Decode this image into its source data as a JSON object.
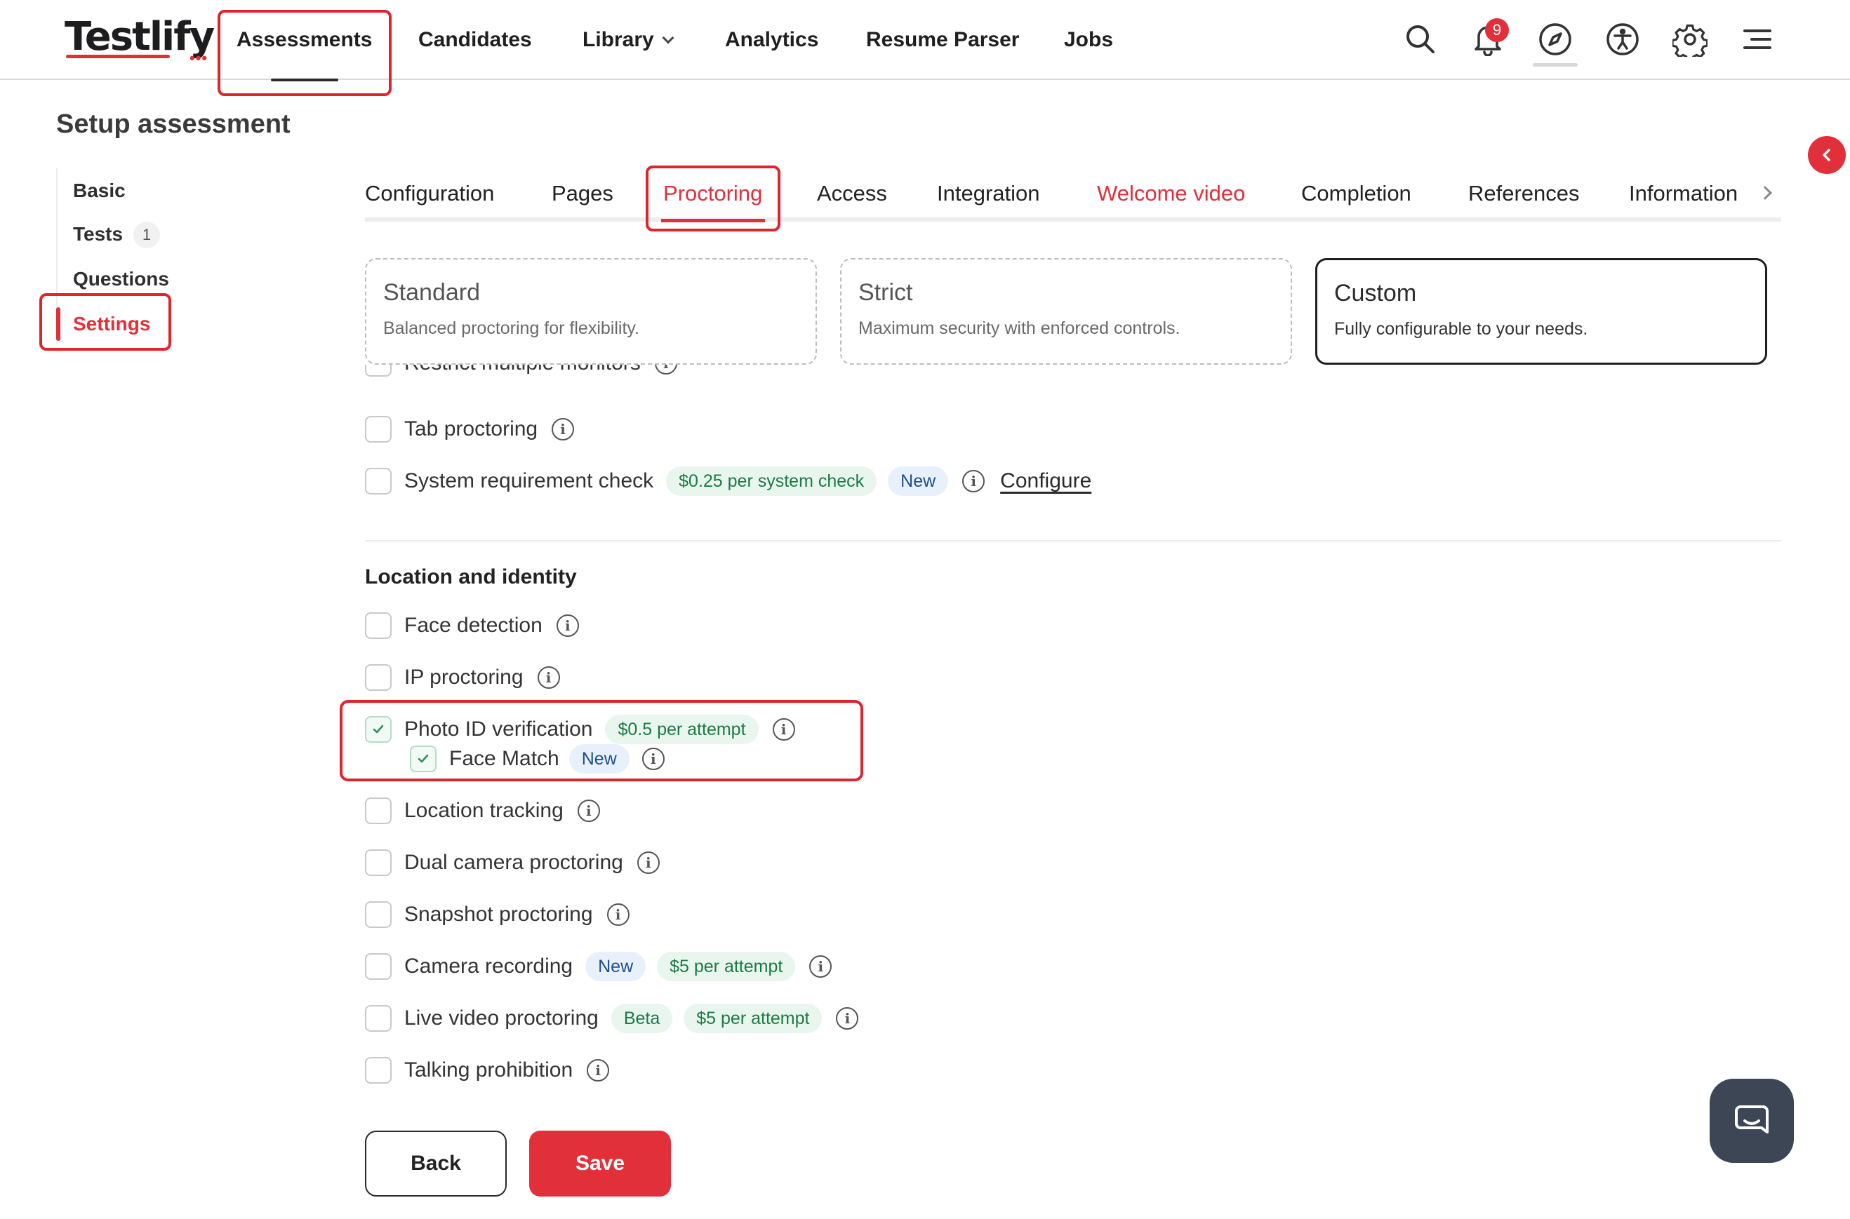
{
  "app": {
    "logo_text": "Testlify",
    "logo_dots": "•••"
  },
  "nav": {
    "assessments": "Assessments",
    "candidates": "Candidates",
    "library": "Library",
    "analytics": "Analytics",
    "resume_parser": "Resume Parser",
    "jobs": "Jobs",
    "notification_count": "9",
    "icons": [
      "search-icon",
      "bell-icon",
      "compass-icon",
      "accessibility-icon",
      "gear-icon",
      "menu-icon"
    ]
  },
  "page": {
    "title": "Setup assessment"
  },
  "sidebar": {
    "items": [
      {
        "label": "Basic"
      },
      {
        "label": "Tests",
        "count": "1"
      },
      {
        "label": "Questions"
      },
      {
        "label": "Settings",
        "active": true
      }
    ]
  },
  "tabs": [
    {
      "label": "Configuration"
    },
    {
      "label": "Pages"
    },
    {
      "label": "Proctoring",
      "active": true
    },
    {
      "label": "Access"
    },
    {
      "label": "Integration"
    },
    {
      "label": "Welcome video"
    },
    {
      "label": "Completion"
    },
    {
      "label": "References"
    },
    {
      "label": "Information"
    }
  ],
  "presets": [
    {
      "title": "Standard",
      "desc": "Balanced proctoring for flexibility."
    },
    {
      "title": "Strict",
      "desc": "Maximum security with enforced controls."
    },
    {
      "title": "Custom",
      "desc": "Fully configurable to your needs.",
      "selected": true
    }
  ],
  "browser_options": {
    "restrict_monitors": "Restrict multiple monitors",
    "tab_proctoring": "Tab proctoring",
    "system_check": "System requirement check",
    "system_check_price": "$0.25 per system check",
    "system_check_new": "New",
    "configure": "Configure"
  },
  "location_section": {
    "title": "Location and identity",
    "face_detection": "Face detection",
    "ip_proctoring": "IP proctoring",
    "photo_id": "Photo ID verification",
    "photo_id_price": "$0.5 per attempt",
    "photo_id_checked": true,
    "face_match": "Face Match",
    "face_match_new": "New",
    "face_match_checked": true,
    "location_tracking": "Location tracking",
    "dual_camera": "Dual camera proctoring",
    "snapshot": "Snapshot proctoring",
    "camera_recording": "Camera recording",
    "camera_recording_new": "New",
    "camera_recording_price": "$5 per attempt",
    "live_video": "Live video proctoring",
    "live_video_beta": "Beta",
    "live_video_price": "$5 per attempt",
    "talking_prohibition": "Talking prohibition"
  },
  "footer": {
    "back": "Back",
    "save": "Save"
  },
  "colors": {
    "accent": "#e2303a",
    "annotation": "#e0242d",
    "price_pill_bg": "#e9f6ee",
    "new_pill_bg": "#e8f1fb"
  }
}
